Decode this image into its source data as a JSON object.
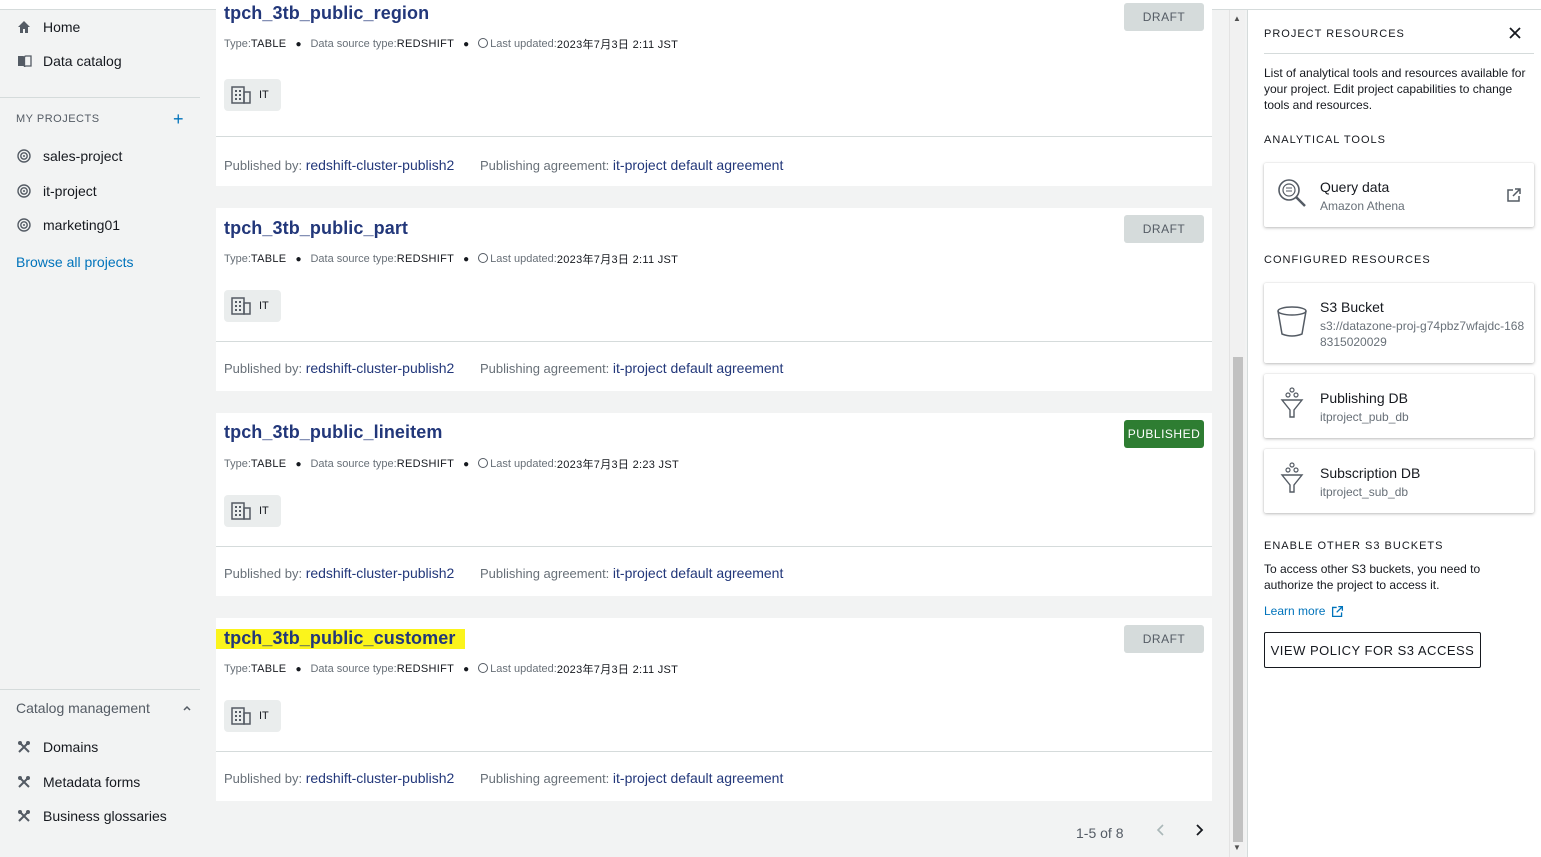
{
  "nav": {
    "home": "Home",
    "data_catalog": "Data catalog",
    "my_projects": "MY PROJECTS",
    "projects": [
      "sales-project",
      "it-project",
      "marketing01"
    ],
    "browse_all": "Browse all projects",
    "catalog_management": "Catalog management",
    "catalog_items": [
      "Domains",
      "Metadata forms",
      "Business glossaries"
    ]
  },
  "assets": [
    {
      "name": "tpch_3tb_public_region",
      "status": "DRAFT",
      "type_label": "Type:",
      "type": "TABLE",
      "source_label": "Data source type:",
      "source": "REDSHIFT",
      "updated_label": "Last updated:",
      "updated": "2023年7月3日 2:11 JST",
      "tag": "IT",
      "published_by_label": "Published by:",
      "published_by": "redshift-cluster-publish2",
      "agreement_label": "Publishing agreement:",
      "agreement": "it-project default agreement"
    },
    {
      "name": "tpch_3tb_public_part",
      "status": "DRAFT",
      "type_label": "Type:",
      "type": "TABLE",
      "source_label": "Data source type:",
      "source": "REDSHIFT",
      "updated_label": "Last updated:",
      "updated": "2023年7月3日 2:11 JST",
      "tag": "IT",
      "published_by_label": "Published by:",
      "published_by": "redshift-cluster-publish2",
      "agreement_label": "Publishing agreement:",
      "agreement": "it-project default agreement"
    },
    {
      "name": "tpch_3tb_public_lineitem",
      "status": "PUBLISHED",
      "type_label": "Type:",
      "type": "TABLE",
      "source_label": "Data source type:",
      "source": "REDSHIFT",
      "updated_label": "Last updated:",
      "updated": "2023年7月3日 2:23 JST",
      "tag": "IT",
      "published_by_label": "Published by:",
      "published_by": "redshift-cluster-publish2",
      "agreement_label": "Publishing agreement:",
      "agreement": "it-project default agreement"
    },
    {
      "name": "tpch_3tb_public_customer",
      "status": "DRAFT",
      "type_label": "Type:",
      "type": "TABLE",
      "source_label": "Data source type:",
      "source": "REDSHIFT",
      "updated_label": "Last updated:",
      "updated": "2023年7月3日 2:11 JST",
      "tag": "IT",
      "published_by_label": "Published by:",
      "published_by": "redshift-cluster-publish2",
      "agreement_label": "Publishing agreement:",
      "agreement": "it-project default agreement"
    }
  ],
  "pagination": {
    "range": "1-5 of 8"
  },
  "panel": {
    "title": "PROJECT RESOURCES",
    "description": "List of analytical tools and resources available for your project. Edit project capabilities to change tools and resources.",
    "analytical_tools_heading": "ANALYTICAL TOOLS",
    "query": {
      "title": "Query data",
      "subtitle": "Amazon Athena"
    },
    "configured_heading": "CONFIGURED RESOURCES",
    "s3": {
      "title": "S3 Bucket",
      "subtitle": "s3://datazone-proj-g74pbz7wfajdc-1688315020029"
    },
    "pub_db": {
      "title": "Publishing DB",
      "subtitle": "itproject_pub_db"
    },
    "sub_db": {
      "title": "Subscription DB",
      "subtitle": "itproject_sub_db"
    },
    "enable_heading": "ENABLE OTHER S3 BUCKETS",
    "enable_text": "To access other S3 buckets, you need to authorize the project to access it.",
    "learn_more": "Learn more",
    "policy_button": "VIEW POLICY FOR S3 ACCESS"
  },
  "colors": {
    "link": "#22377a",
    "published_badge": "#2e7d32",
    "draft_badge": "#d5dbdb",
    "highlight": "#fbf41c"
  }
}
